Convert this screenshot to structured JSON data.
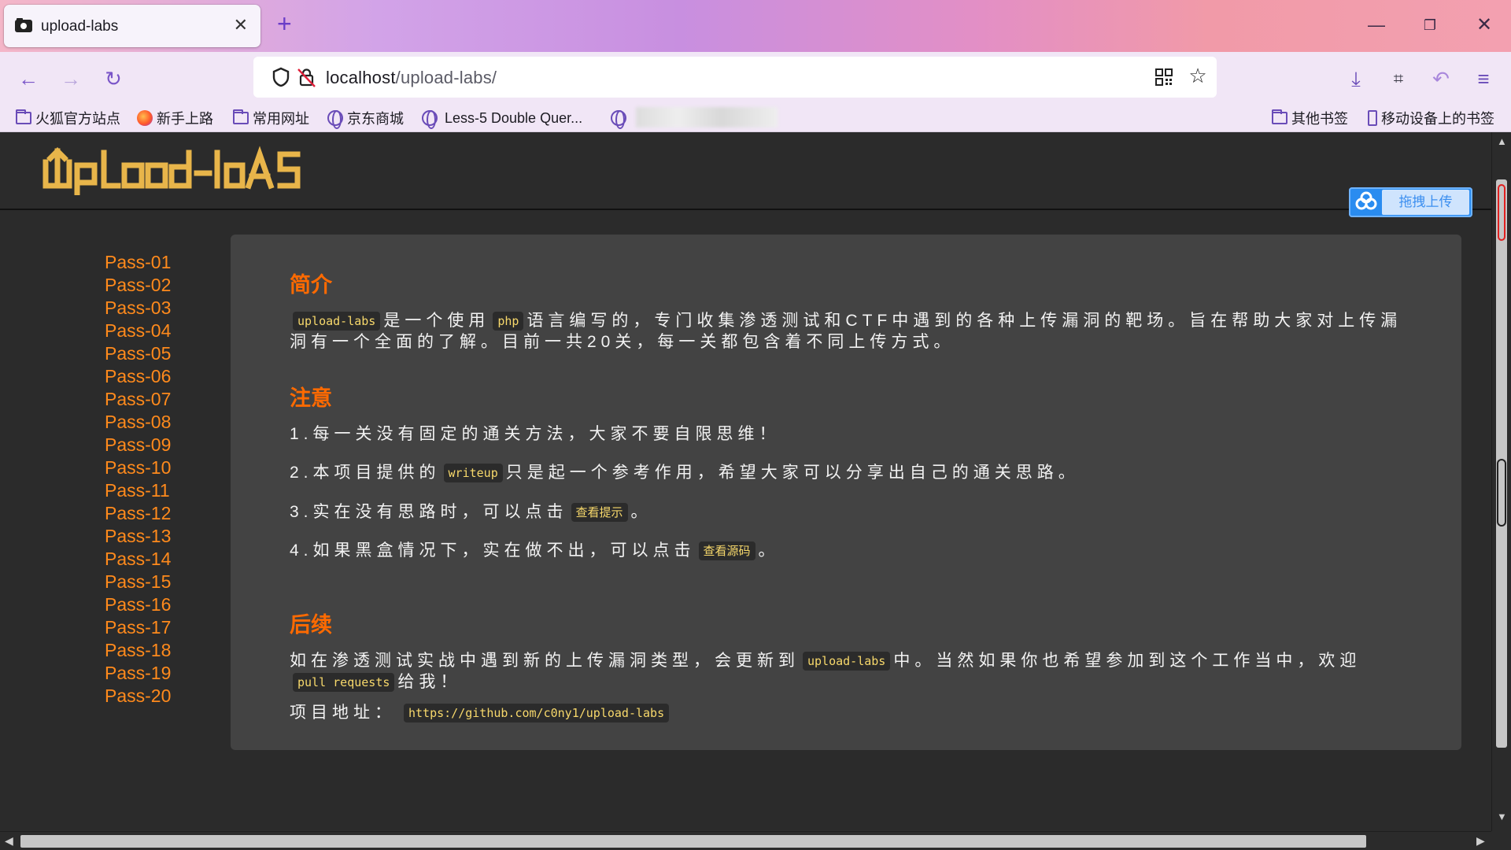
{
  "browser": {
    "tab_title": "upload-labs",
    "url_host": "localhost",
    "url_path": "/upload-labs/",
    "bookmarks": [
      "火狐官方站点",
      "新手上路",
      "常用网址",
      "京东商城",
      "Less-5 Double Quer...",
      "其他书签",
      "移动设备上的书签"
    ]
  },
  "site": {
    "drag_upload_label": "拖拽上传",
    "nav": [
      "Pass-01",
      "Pass-02",
      "Pass-03",
      "Pass-04",
      "Pass-05",
      "Pass-06",
      "Pass-07",
      "Pass-08",
      "Pass-09",
      "Pass-10",
      "Pass-11",
      "Pass-12",
      "Pass-13",
      "Pass-14",
      "Pass-15",
      "Pass-16",
      "Pass-17",
      "Pass-18",
      "Pass-19",
      "Pass-20"
    ]
  },
  "content": {
    "intro_heading": "简介",
    "intro_code1": "upload-labs",
    "intro_t1": "是一个使用",
    "intro_code2": "php",
    "intro_t2": "语言编写的，专门收集渗透测试和CTF中遇到的各种上传漏洞的靶场。旨在帮助大家对上传漏洞有一个全面的了解。目前一共20关，每一关都包含着不同上传方式。",
    "notice_heading": "注意",
    "n1": "1.每一关没有固定的通关方法，大家不要自限思维！",
    "n2_a": "2.本项目提供的",
    "n2_code": "writeup",
    "n2_b": "只是起一个参考作用，希望大家可以分享出自己的通关思路。",
    "n3_a": "3.实在没有思路时，可以点击",
    "n3_btn": "查看提示",
    "n3_b": "。",
    "n4_a": "4.如果黑盒情况下，实在做不出，可以点击",
    "n4_btn": "查看源码",
    "n4_b": "。",
    "follow_heading": "后续",
    "f_a": "如在渗透测试实战中遇到新的上传漏洞类型，会更新到",
    "f_code1": "upload-labs",
    "f_b": "中。当然如果你也希望参加到这个工作当中，欢迎",
    "f_code2": "pull requests",
    "f_c": "给我！",
    "addr_label": "项目地址：",
    "addr_link": "https://github.com/c0ny1/upload-labs"
  }
}
